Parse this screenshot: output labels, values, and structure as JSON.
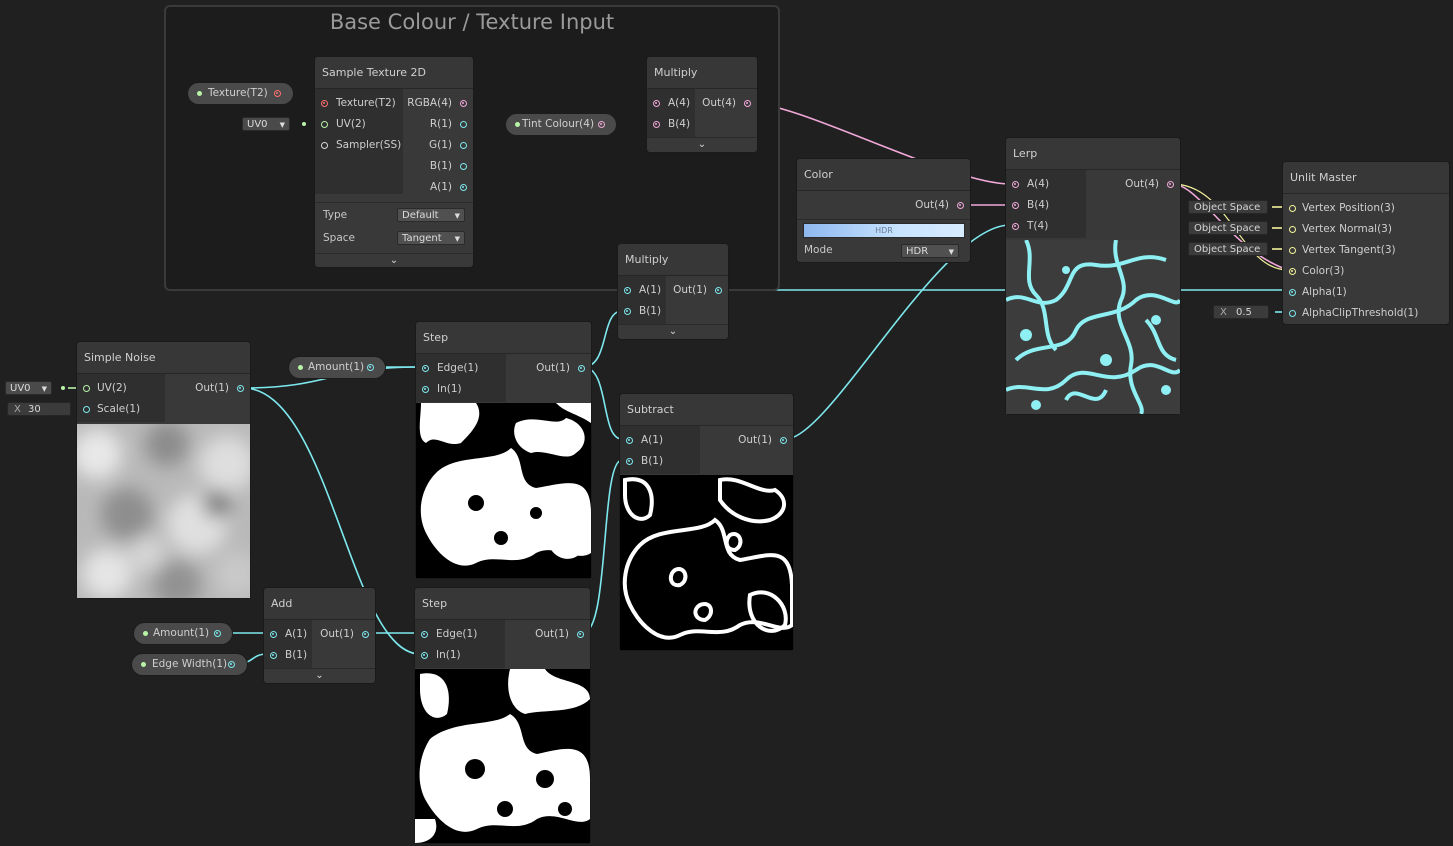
{
  "group": {
    "title": "Base Colour / Texture Input"
  },
  "colors": {
    "background": "#202020",
    "node": "#393939",
    "wire_cyan": "#7de8ee",
    "wire_pink": "#f0a8d8",
    "wire_yellow": "#f3f39c"
  },
  "nodes": {
    "sample_texture": {
      "title": "Sample Texture 2D",
      "inputs": [
        "Texture(T2)",
        "UV(2)",
        "Sampler(SS)"
      ],
      "outputs": [
        "RGBA(4)",
        "R(1)",
        "G(1)",
        "B(1)",
        "A(1)"
      ],
      "type_label": "Type",
      "type_value": "Default",
      "space_label": "Space",
      "space_value": "Tangent"
    },
    "multiply_top": {
      "title": "Multiply",
      "inputs": [
        "A(4)",
        "B(4)"
      ],
      "output": "Out(4)"
    },
    "multiply_mid": {
      "title": "Multiply",
      "inputs": [
        "A(1)",
        "B(1)"
      ],
      "output": "Out(1)"
    },
    "color": {
      "title": "Color",
      "output": "Out(4)",
      "swatch_label": "HDR",
      "mode_label": "Mode",
      "mode_value": "HDR"
    },
    "lerp": {
      "title": "Lerp",
      "inputs": [
        "A(4)",
        "B(4)",
        "T(4)"
      ],
      "output": "Out(4)"
    },
    "unlit_master": {
      "title": "Unlit Master",
      "inputs": [
        "Vertex Position(3)",
        "Vertex Normal(3)",
        "Vertex Tangent(3)",
        "Color(3)",
        "Alpha(1)",
        "AlphaClipThreshold(1)"
      ],
      "space_fields": [
        "Object Space",
        "Object Space",
        "Object Space"
      ],
      "clip_axis": "X",
      "clip_value": "0.5"
    },
    "simple_noise": {
      "title": "Simple Noise",
      "inputs": [
        "UV(2)",
        "Scale(1)"
      ],
      "output": "Out(1)",
      "uv_value": "UV0",
      "scale_axis": "X",
      "scale_value": "30"
    },
    "step_top": {
      "title": "Step",
      "inputs": [
        "Edge(1)",
        "In(1)"
      ],
      "output": "Out(1)"
    },
    "step_bottom": {
      "title": "Step",
      "inputs": [
        "Edge(1)",
        "In(1)"
      ],
      "output": "Out(1)"
    },
    "subtract": {
      "title": "Subtract",
      "inputs": [
        "A(1)",
        "B(1)"
      ],
      "output": "Out(1)"
    },
    "add": {
      "title": "Add",
      "inputs": [
        "A(1)",
        "B(1)"
      ],
      "output": "Out(1)"
    }
  },
  "properties": {
    "texture": "Texture(T2)",
    "tint_colour": "Tint Colour(4)",
    "amount_step": "Amount(1)",
    "amount_add": "Amount(1)",
    "edge_width": "Edge Width(1)"
  },
  "uv_dropdown": "UV0"
}
